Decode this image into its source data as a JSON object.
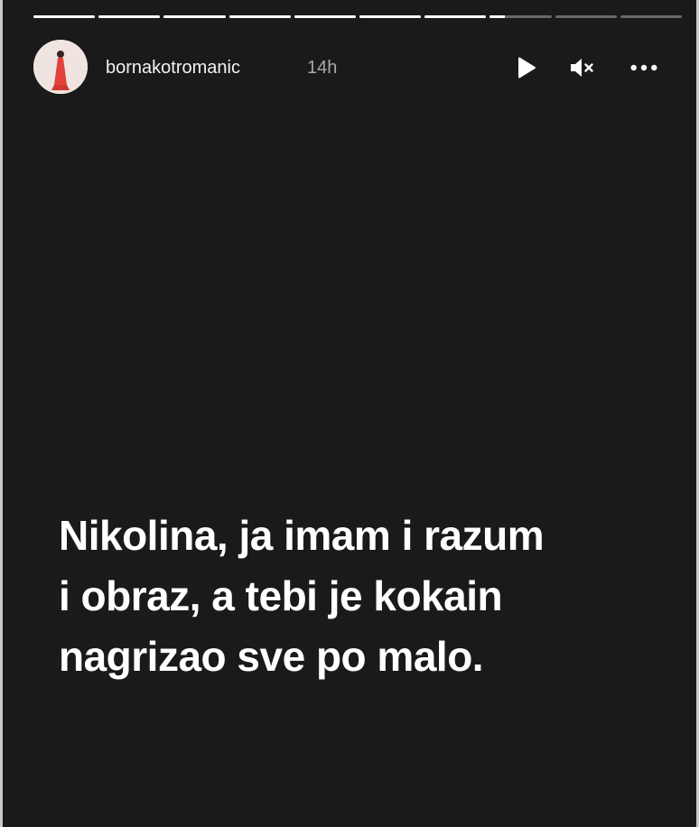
{
  "story": {
    "username": "bornakotromanic",
    "time_ago": "14h",
    "progress": {
      "segments_total": 10,
      "segments_complete": 7,
      "current_segment_fraction": 0.25
    },
    "controls": {
      "play_icon": "play-icon",
      "mute_icon": "speaker-muted-icon",
      "more_icon": "more-horizontal-icon"
    },
    "caption_lines": [
      "Nikolina, ja imam i razum",
      "i obraz, a tebi je kokain",
      "nagrizao sve po malo."
    ]
  },
  "colors": {
    "background": "#1a1a1a",
    "text": "#ffffff",
    "muted": "#a8a8a8"
  }
}
